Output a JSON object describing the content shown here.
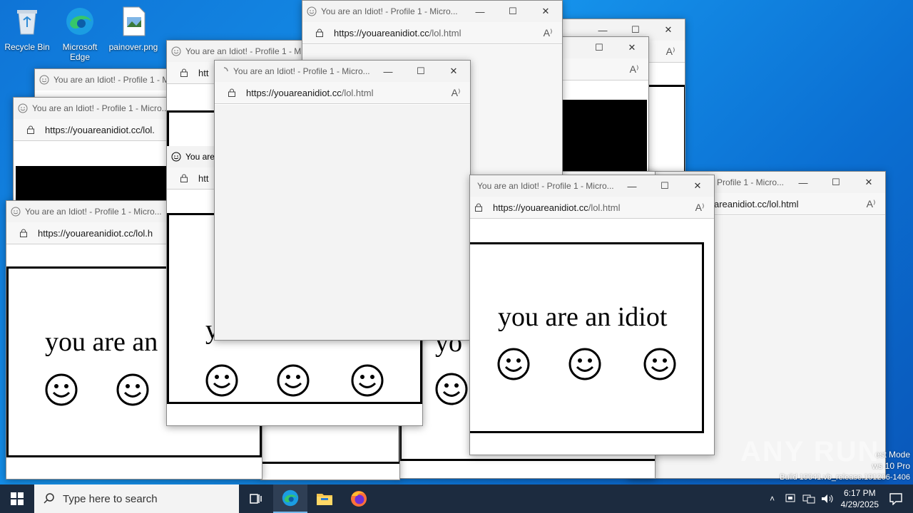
{
  "desktop": {
    "icons": [
      {
        "label": "Recycle Bin",
        "icon": "recycle-bin-icon"
      },
      {
        "label": "Microsoft Edge",
        "icon": "edge-icon"
      },
      {
        "label": "painover.png",
        "icon": "image-file-icon"
      }
    ]
  },
  "browser": {
    "window_title": "You are an Idiot! - Profile 1 - Micro...",
    "window_title_short_a": "You are an Idiot! - Profile 1 - M",
    "window_title_short_b": "You are an Idiot! - Profile 1 - Mi",
    "window_title_tail": "Profile 1 - Micro...",
    "window_title_cut": "You are",
    "url_host": "https://youareanidiot.cc",
    "url_path": "/lol.html",
    "url_cut_a": "https://youareanidiot.cc/lol.",
    "url_cut_b": "https://youareanidiot.cc/lol.h",
    "url_cut_c": "htt",
    "url_cut_d": "htt",
    "url_tail": "areanidiot.cc/lol.html",
    "read_aloud_icon": "read-aloud-icon",
    "page_text": "you are an idiot",
    "page_text_cut": "you are an",
    "page_text_y": "y",
    "page_text_yo": "yo",
    "page_text_idiot_fragment": "idiot"
  },
  "taskbar": {
    "search_placeholder": "Type here to search",
    "time": "6:17 PM",
    "date": "4/29/2025",
    "pinned": [
      "task-view-icon",
      "edge-icon",
      "file-explorer-icon",
      "firefox-icon"
    ]
  },
  "watermark": {
    "line1": "est Mode",
    "line2": "ws 10 Pro",
    "line3": "Build 19041.vb_release.191206-1406",
    "brand": "ANY RUN"
  },
  "colors": {
    "desktop": "#0f74d6",
    "taskbar": "#1c2b3f",
    "accent": "#76b9ed"
  }
}
